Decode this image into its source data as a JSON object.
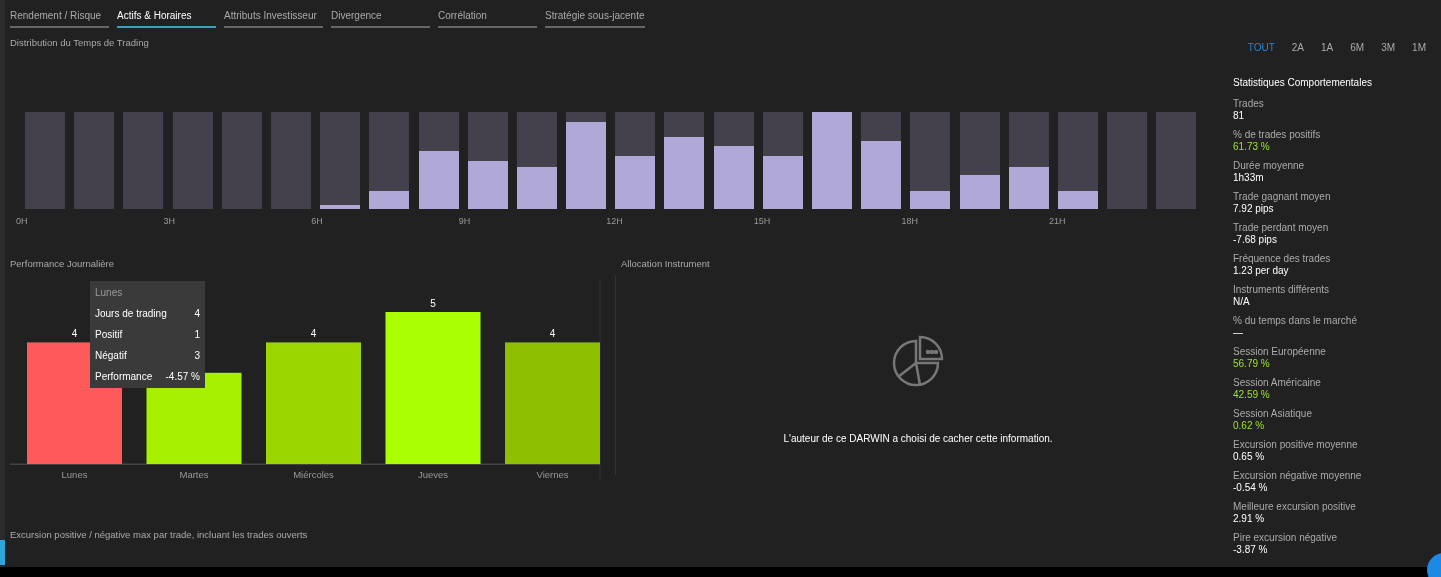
{
  "tabs": [
    {
      "label": "Rendement / Risque",
      "selected": false
    },
    {
      "label": "Actifs & Horaires",
      "selected": true
    },
    {
      "label": "Attributs Investisseur",
      "selected": false
    },
    {
      "label": "Divergence",
      "selected": false
    },
    {
      "label": "Corrélation",
      "selected": false
    },
    {
      "label": "Stratégie sous-jacente",
      "selected": false
    }
  ],
  "trading_time": {
    "title": "Distribution du Temps de Trading",
    "hours": [
      {
        "level": 0,
        "label": "0H"
      },
      {
        "level": 0
      },
      {
        "level": 0
      },
      {
        "level": 0,
        "label": "3H"
      },
      {
        "level": 0
      },
      {
        "level": 0
      },
      {
        "level": 0.04,
        "label": "6H"
      },
      {
        "level": 0.19
      },
      {
        "level": 0.6
      },
      {
        "level": 0.5,
        "label": "9H"
      },
      {
        "level": 0.44
      },
      {
        "level": 0.9
      },
      {
        "level": 0.55,
        "label": "12H"
      },
      {
        "level": 0.75
      },
      {
        "level": 0.65
      },
      {
        "level": 0.55,
        "label": "15H"
      },
      {
        "level": 1
      },
      {
        "level": 0.7
      },
      {
        "level": 0.19,
        "label": "18H"
      },
      {
        "level": 0.35
      },
      {
        "level": 0.44
      },
      {
        "level": 0.19,
        "label": "21H"
      },
      {
        "level": 0
      },
      {
        "level": 0
      }
    ]
  },
  "ranges": [
    {
      "label": "TOUT",
      "selected": true
    },
    {
      "label": "2A",
      "selected": false
    },
    {
      "label": "1A",
      "selected": false
    },
    {
      "label": "6M",
      "selected": false
    },
    {
      "label": "3M",
      "selected": false
    },
    {
      "label": "1M",
      "selected": false
    }
  ],
  "daily": {
    "title": "Performance Journalière",
    "chart_data": {
      "type": "bar",
      "categories": [
        "Lunes",
        "Martes",
        "Miércoles",
        "Jueves",
        "Viernes"
      ],
      "values": [
        4,
        3,
        4,
        5,
        4
      ],
      "colors": [
        "#ff5a5a",
        "#a6f000",
        "#9bd600",
        "#aaff00",
        "#8fc000"
      ],
      "value_labels": [
        "4",
        null,
        "4",
        "5",
        "4"
      ]
    },
    "tooltip": {
      "title": "Lunes",
      "rows": [
        {
          "label": "Jours de trading",
          "value": "4"
        },
        {
          "label": "Positif",
          "value": "1"
        },
        {
          "label": "Négatif",
          "value": "3"
        },
        {
          "label": "Performance",
          "value": "-4.57 %"
        }
      ]
    }
  },
  "allocation": {
    "title": "Allocation Instrument",
    "message": "L'auteur de ce DARWIN a choisi de cacher cette information."
  },
  "excursion": {
    "title": "Excursion positive / négative max par trade, incluant les trades ouverts"
  },
  "stats": {
    "title": "Statistiques Comportementales",
    "items": [
      {
        "label": "Trades",
        "value": "81",
        "highlighted": false
      },
      {
        "label": "% de trades positifs",
        "value": "61.73 %",
        "highlighted": true
      },
      {
        "label": "Durée moyenne",
        "value": "1h33m",
        "highlighted": false
      },
      {
        "label": "Trade gagnant moyen",
        "value": "7.92 pips",
        "highlighted": false
      },
      {
        "label": "Trade perdant moyen",
        "value": "-7.68 pips",
        "highlighted": false
      },
      {
        "label": "Fréquence des trades",
        "value": "1.23 per day",
        "highlighted": false
      },
      {
        "label": "Instruments différents",
        "value": "N/A",
        "highlighted": false
      },
      {
        "label": "% du temps dans le marché",
        "value": "—",
        "highlighted": false
      },
      {
        "label": "Session Européenne",
        "value": "56.79 %",
        "highlighted": true
      },
      {
        "label": "Session Américaine",
        "value": "42.59 %",
        "highlighted": true
      },
      {
        "label": "Session Asiatique",
        "value": "0.62 %",
        "highlighted": true
      },
      {
        "label": "Excursion positive moyenne",
        "value": "0.65 %",
        "highlighted": false
      },
      {
        "label": "Excursion négative moyenne",
        "value": "-0.54 %",
        "highlighted": false
      },
      {
        "label": "Meilleure excursion positive",
        "value": "2.91 %",
        "highlighted": false
      },
      {
        "label": "Pire excursion négative",
        "value": "-3.87 %",
        "highlighted": false
      }
    ]
  }
}
